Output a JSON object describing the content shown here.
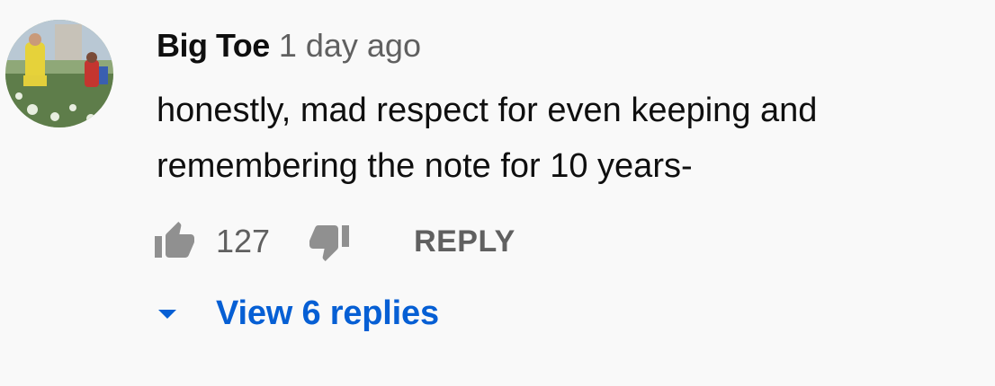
{
  "comment": {
    "author": "Big Toe",
    "timestamp": "1 day ago",
    "text_line1": "honestly, mad respect for even keeping and",
    "text_line2": "remembering the note for 10 years-",
    "avatar": "user-avatar-photo",
    "actions": {
      "like_icon": "thumbs-up-icon",
      "like_count": "127",
      "dislike_icon": "thumbs-down-icon",
      "reply_label": "REPLY"
    },
    "replies": {
      "toggle_icon": "caret-down-icon",
      "label": "View 6 replies"
    }
  },
  "colors": {
    "background": "#f9f9f9",
    "primary_text": "#0f0f0f",
    "secondary_text": "#606060",
    "link": "#065fd4"
  }
}
